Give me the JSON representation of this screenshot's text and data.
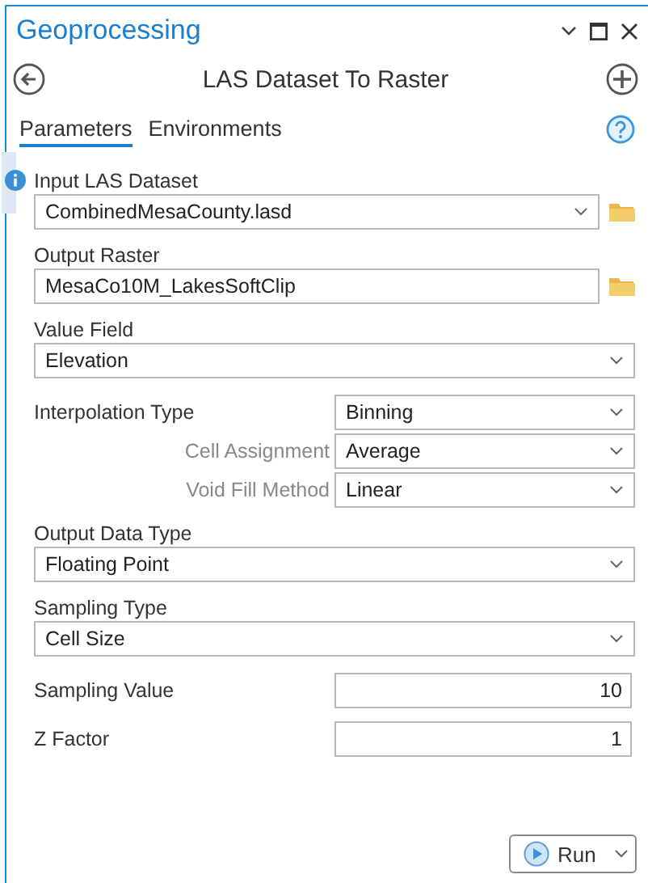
{
  "window": {
    "title": "Geoprocessing"
  },
  "tool": {
    "title": "LAS Dataset To Raster"
  },
  "tabs": [
    {
      "label": "Parameters",
      "selected": true
    },
    {
      "label": "Environments",
      "selected": false
    }
  ],
  "parameters": [
    {
      "kind": "file-dropdown",
      "label": "Input LAS Dataset",
      "value": "CombinedMesaCounty.lasd",
      "info": true
    },
    {
      "kind": "file-text",
      "label": "Output Raster",
      "value": "MesaCo10M_LakesSoftClip",
      "info": false
    },
    {
      "kind": "dropdown",
      "label": "Value Field",
      "value": "Elevation",
      "info": false
    },
    {
      "kind": "inline-dropdown",
      "label": "Interpolation Type",
      "value": "Binning",
      "info": false
    },
    {
      "kind": "sub-dropdown",
      "label": "Cell Assignment",
      "value": "Average",
      "info": false
    },
    {
      "kind": "sub-dropdown",
      "label": "Void Fill Method",
      "value": "Linear",
      "info": false
    },
    {
      "kind": "dropdown",
      "label": "Output Data Type",
      "value": "Floating Point",
      "info": false
    },
    {
      "kind": "dropdown",
      "label": "Sampling Type",
      "value": "Cell Size",
      "info": false
    },
    {
      "kind": "number",
      "label": "Sampling Value",
      "value": "10",
      "info": false
    },
    {
      "kind": "number",
      "label": "Z Factor",
      "value": "1",
      "info": false
    }
  ],
  "run_button": {
    "label": "Run"
  }
}
